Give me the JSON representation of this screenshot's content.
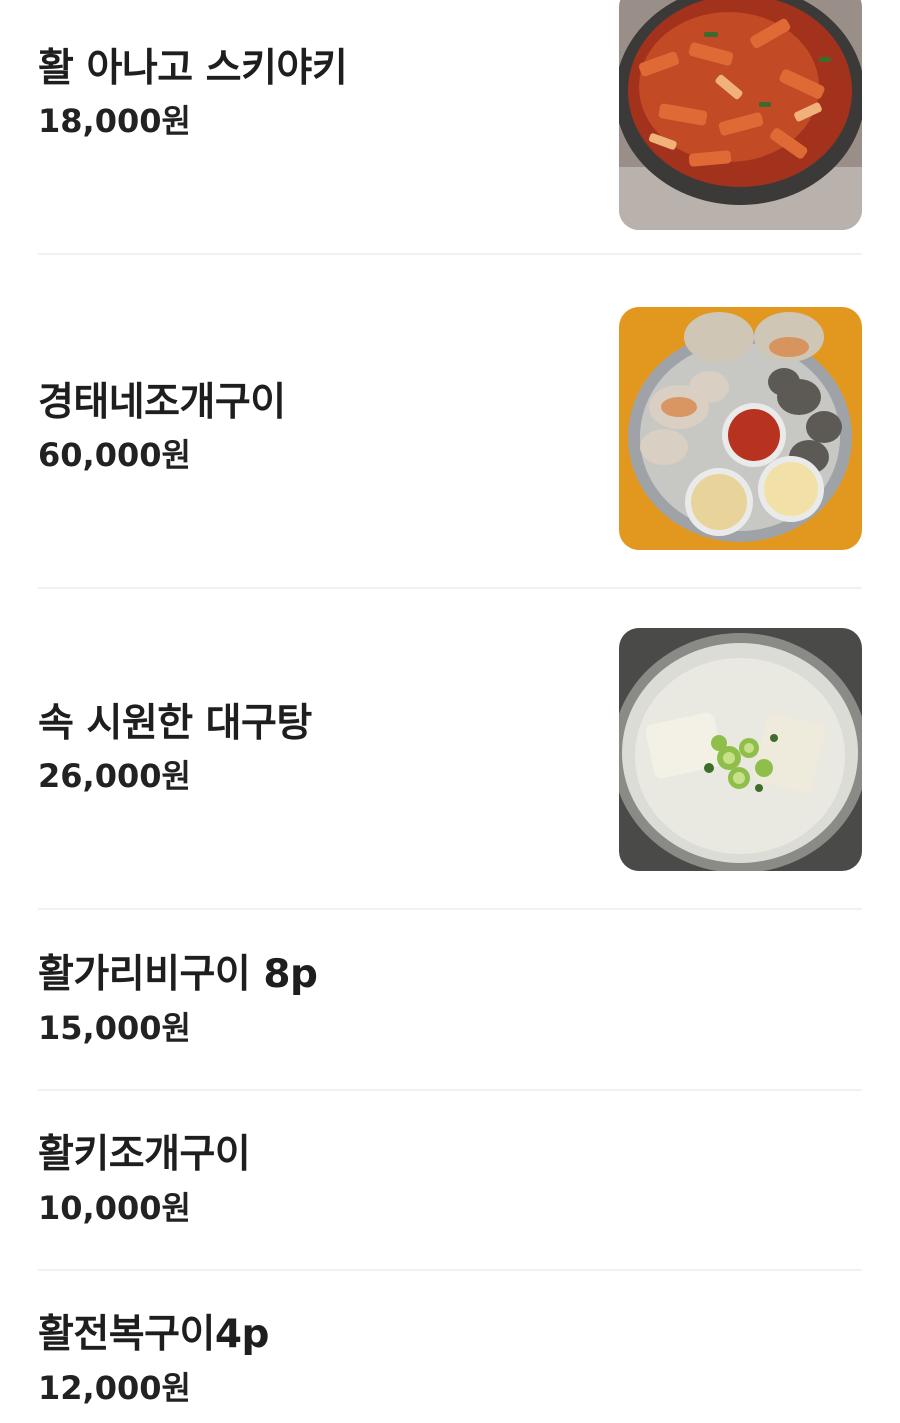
{
  "menu": {
    "items": [
      {
        "name": "활 아나고 스키야키",
        "price": "18,000원",
        "image": "spicy-eel-sukiyaki-hotpot"
      },
      {
        "name": "경태네조개구이",
        "price": "60,000원",
        "image": "grilled-shellfish-platter"
      },
      {
        "name": "속 시원한 대구탕",
        "price": "26,000원",
        "image": "cod-soup"
      },
      {
        "name": "활가리비구이 8p",
        "price": "15,000원"
      },
      {
        "name": "활키조개구이",
        "price": "10,000원"
      },
      {
        "name": "활전복구이4p",
        "price": "12,000원"
      }
    ]
  },
  "colors": {
    "text": "#1e1e1e",
    "divider": "#f1f1f1",
    "background": "#ffffff"
  }
}
